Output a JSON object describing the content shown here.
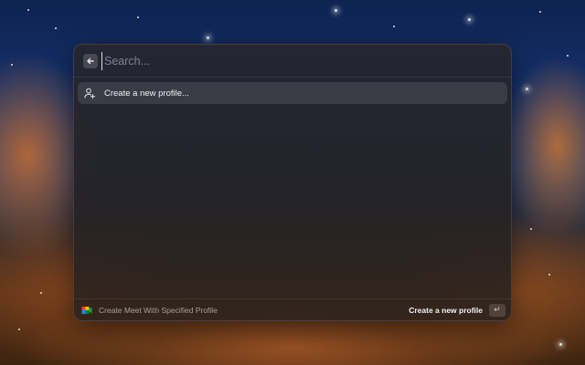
{
  "search": {
    "placeholder": "Search...",
    "back_icon": "arrow-left-icon"
  },
  "list": {
    "items": [
      {
        "label": "Create a new profile...",
        "icon": "user-add-icon"
      }
    ]
  },
  "footer": {
    "extension_icon": "google-meet-icon",
    "extension_title": "Create Meet With Specified Profile",
    "primary_action": "Create a new profile",
    "enter_key_icon": "return-key-icon"
  },
  "colors": {
    "meet_green": "#00832d",
    "meet_blue": "#2684fc",
    "meet_yellow": "#ffba00",
    "meet_red": "#ea4335"
  }
}
